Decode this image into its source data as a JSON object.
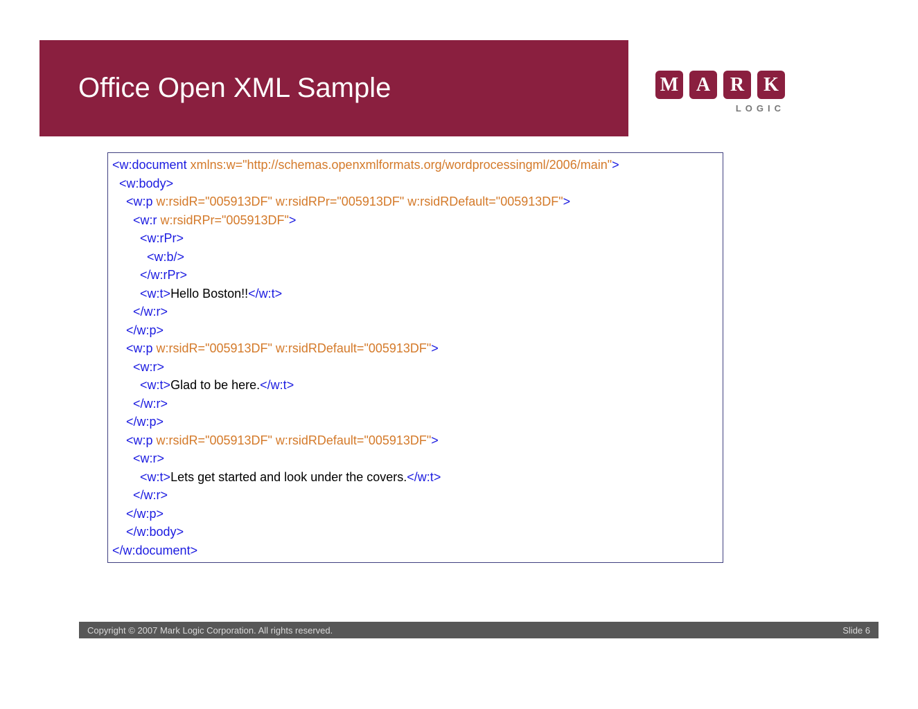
{
  "slide": {
    "title": "Office Open XML Sample",
    "logo": {
      "letters": [
        "M",
        "A",
        "R",
        "K"
      ],
      "subtitle": "LOGIC"
    },
    "footer": {
      "copyright": "Copyright © 2007 Mark Logic Corporation.  All rights reserved.",
      "slide_label": "Slide 6"
    }
  },
  "xml": {
    "elements": {
      "document_open": "w:document",
      "document_close": "/w:document",
      "body_open": "w:body",
      "body_close": "/w:body",
      "p_open": "w:p",
      "p_close": "/w:p",
      "r_open": "w:r",
      "r_close": "/w:r",
      "rPr_open": "w:rPr",
      "rPr_close": "/w:rPr",
      "b_self": "w:b/",
      "t_open": "w:t",
      "t_close": "/w:t"
    },
    "attrs": {
      "doc_ns": " xmlns:w=\"http://schemas.openxmlformats.org/wordprocessingml/2006/main\"",
      "p1": " w:rsidR=\"005913DF\" w:rsidRPr=\"005913DF\" w:rsidRDefault=\"005913DF\"",
      "r1": " w:rsidRPr=\"005913DF\"",
      "p2": " w:rsidR=\"005913DF\" w:rsidRDefault=\"005913DF\"",
      "p3": " w:rsidR=\"005913DF\" w:rsidRDefault=\"005913DF\""
    },
    "texts": {
      "t1": "Hello Boston!!",
      "t2": "Glad to be here.",
      "t3": "Lets get started and look under the covers."
    }
  }
}
